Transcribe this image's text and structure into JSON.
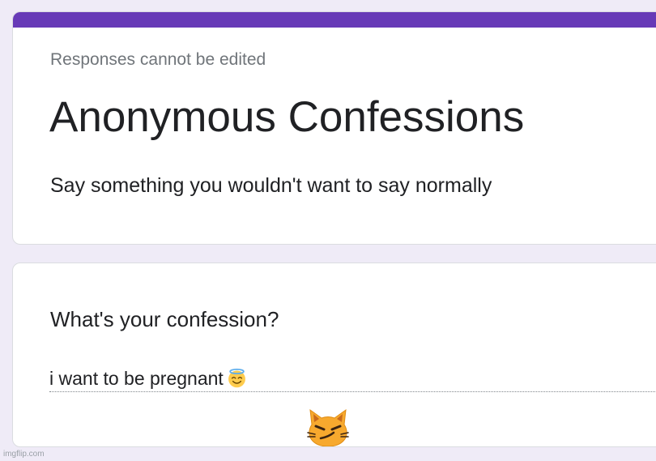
{
  "header": {
    "notice": "Responses cannot be edited",
    "title": "Anonymous Confessions",
    "description": "Say something you wouldn't want to say normally"
  },
  "question": {
    "title": "What's your confession?",
    "answer": "i want to be pregnant",
    "answer_emoji": "smiling-face-with-halo-icon"
  },
  "decorations": {
    "overlay_emoji": "smirking-cat-icon"
  },
  "watermark": "imgflip.com",
  "colors": {
    "page_background": "#efebf7",
    "accent": "#673ab7",
    "text_primary": "#202124",
    "text_secondary": "#70757a"
  }
}
